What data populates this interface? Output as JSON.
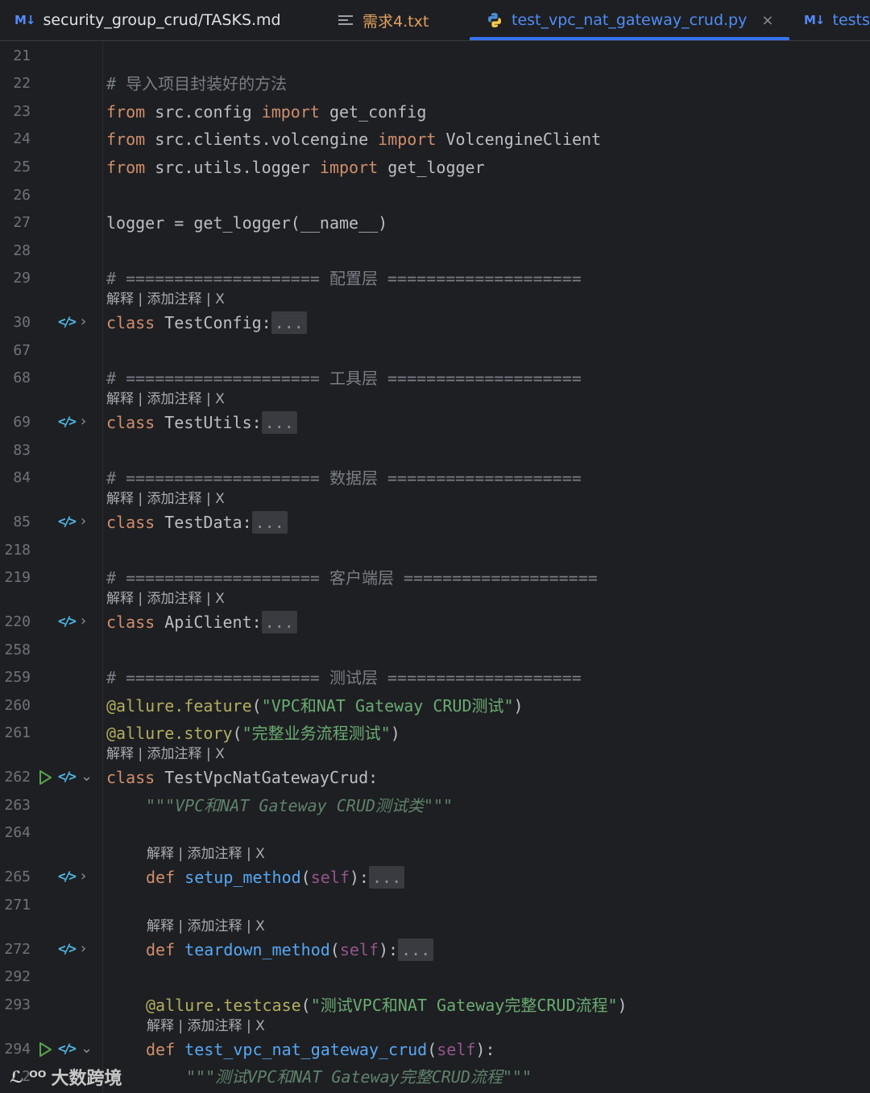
{
  "tabs": [
    {
      "icon": "markdown-icon",
      "icon_text": "M↓",
      "label": "security_group_crud/TASKS.md",
      "active": false
    },
    {
      "icon": "text-file-icon",
      "label": "需求4.txt",
      "active": false
    },
    {
      "icon": "python-icon",
      "label": "test_vpc_nat_gateway_crud.py",
      "active": true,
      "close": "×"
    },
    {
      "icon": "markdown-icon",
      "icon_text": "M↓",
      "label": "tests",
      "active": false
    }
  ],
  "inlay_hint": "解释 | 添加注释 | X",
  "fold_placeholder": "...",
  "lines": {
    "l21": "21",
    "l22": "22",
    "l23": "23",
    "l24": "24",
    "l25": "25",
    "l26": "26",
    "l27": "27",
    "l28": "28",
    "l29": "29",
    "l30": "30",
    "l67": "67",
    "l68": "68",
    "l69": "69",
    "l83": "83",
    "l84": "84",
    "l85": "85",
    "l218": "218",
    "l219": "219",
    "l220": "220",
    "l258": "258",
    "l259": "259",
    "l260": "260",
    "l261": "261",
    "l262": "262",
    "l263": "263",
    "l264": "264",
    "l265": "265",
    "l271": "271",
    "l272": "272",
    "l292": "292",
    "l293": "293",
    "l294": "294",
    "l295": "2"
  },
  "code": {
    "c22": "# 导入项目封装好的方法",
    "c23_kw": "from",
    "c23_mod": " src.config ",
    "c23_imp": "import",
    "c23_name": " get_config",
    "c24_kw": "from",
    "c24_mod": " src.clients.volcengine ",
    "c24_imp": "import",
    "c24_name": " VolcengineClient",
    "c25_kw": "from",
    "c25_mod": " src.utils.logger ",
    "c25_imp": "import",
    "c25_name": " get_logger",
    "c27": "logger = get_logger(__name__)",
    "c29": "# ==================== 配置层 ====================",
    "c30_kw": "class",
    "c30_name": " TestConfig:",
    "c68": "# ==================== 工具层 ====================",
    "c69_kw": "class",
    "c69_name": " TestUtils:",
    "c84": "# ==================== 数据层 ====================",
    "c85_kw": "class",
    "c85_name": " TestData:",
    "c219": "# ==================== 客户端层 ====================",
    "c220_kw": "class",
    "c220_name": " ApiClient:",
    "c259": "# ==================== 测试层 ====================",
    "c260_dec": "@allure.feature",
    "c260_p1": "(",
    "c260_str": "\"VPC和NAT Gateway CRUD测试\"",
    "c260_p2": ")",
    "c261_dec": "@allure.story",
    "c261_p1": "(",
    "c261_str": "\"完整业务流程测试\"",
    "c261_p2": ")",
    "c262_kw": "class",
    "c262_name": " TestVpcNatGatewayCrud:",
    "c263": "\"\"\"VPC和NAT Gateway CRUD测试类\"\"\"",
    "c265_kw": "def",
    "c265_fn": " setup_method",
    "c265_p1": "(",
    "c265_self": "self",
    "c265_p2": "):",
    "c272_kw": "def",
    "c272_fn": " teardown_method",
    "c272_p1": "(",
    "c272_self": "self",
    "c272_p2": "):",
    "c293_dec": "@allure.testcase",
    "c293_p1": "(",
    "c293_str": "\"测试VPC和NAT Gateway完整CRUD流程\"",
    "c293_p2": ")",
    "c294_kw": "def",
    "c294_fn": " test_vpc_nat_gateway_crud",
    "c294_p1": "(",
    "c294_self": "self",
    "c294_p2": "):",
    "c295": "\"\"\"测试VPC和NAT Gateway完整CRUD流程\"\"\""
  },
  "watermark": {
    "logo": "ℒ ᴼᴼ",
    "text": "大数跨境"
  },
  "colors": {
    "background": "#1e1f22",
    "keyword": "#cf8e6d",
    "function": "#56a8f5",
    "string": "#6aab73",
    "comment": "#7a7e85",
    "docstring": "#5f826b",
    "decorator": "#b3ae60",
    "self": "#94558d",
    "accent": "#3574f0"
  }
}
